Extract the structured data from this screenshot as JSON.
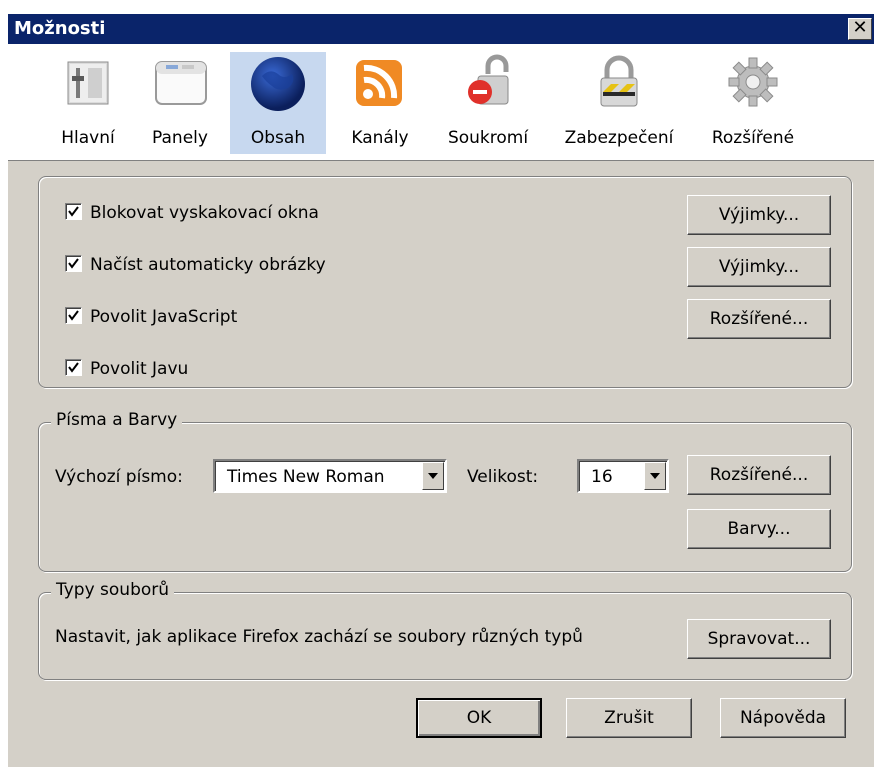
{
  "window": {
    "title": "Možnosti",
    "close_label": "✕"
  },
  "toolbar": {
    "items": [
      {
        "label": "Hlavní",
        "icon": "main-settings-icon"
      },
      {
        "label": "Panely",
        "icon": "tabs-window-icon"
      },
      {
        "label": "Obsah",
        "icon": "globe-icon",
        "selected": true
      },
      {
        "label": "Kanály",
        "icon": "rss-feed-icon"
      },
      {
        "label": "Soukromí",
        "icon": "privacy-lock-icon"
      },
      {
        "label": "Zabezpečení",
        "icon": "security-padlock-icon"
      },
      {
        "label": "Rozšířené",
        "icon": "gear-icon"
      }
    ]
  },
  "content": {
    "popups": {
      "label": "Blokovat vyskakovací okna",
      "checked": true,
      "button": "Výjimky..."
    },
    "images": {
      "label": "Načíst automaticky obrázky",
      "checked": true,
      "button": "Výjimky..."
    },
    "javascript": {
      "label": "Povolit JavaScript",
      "checked": true,
      "button": "Rozšířené..."
    },
    "java": {
      "label": "Povolit Javu",
      "checked": true
    }
  },
  "fonts": {
    "legend": "Písma a Barvy",
    "default_font_label": "Výchozí písmo:",
    "default_font_value": "Times New Roman",
    "size_label": "Velikost:",
    "size_value": "16",
    "advanced_button": "Rozšířené...",
    "colors_button": "Barvy..."
  },
  "filetypes": {
    "legend": "Typy souborů",
    "description": "Nastavit, jak aplikace Firefox zachází se soubory různých typů",
    "manage_button": "Spravovat..."
  },
  "footer": {
    "ok": "OK",
    "cancel": "Zrušit",
    "help": "Nápověda"
  }
}
